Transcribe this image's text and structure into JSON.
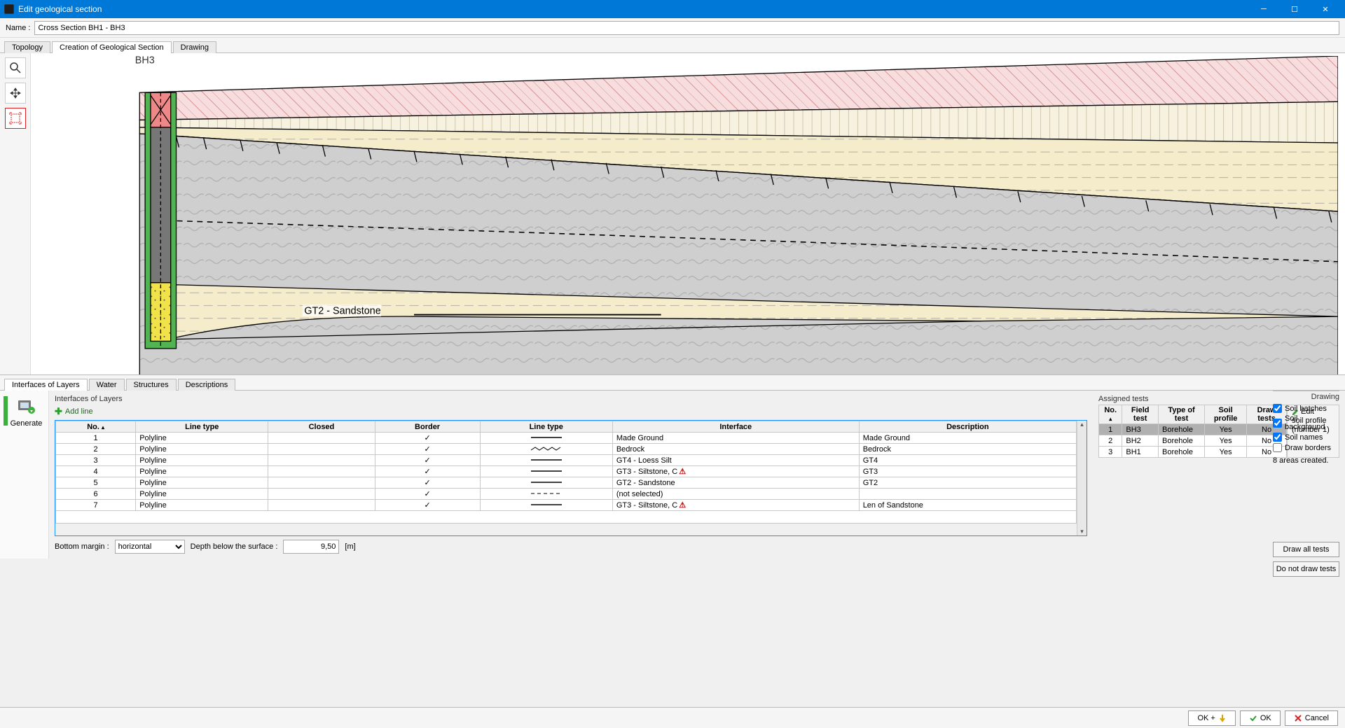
{
  "window": {
    "title": "Edit geological section"
  },
  "name_row": {
    "label": "Name :",
    "value": "Cross Section BH1 - BH3"
  },
  "main_tabs": [
    "Topology",
    "Creation of Geological Section",
    "Drawing"
  ],
  "active_main_tab": 1,
  "canvas": {
    "bh_label": "BH3",
    "lens_label": "GT2 - Sandstone"
  },
  "sub_tabs": [
    "Interfaces of Layers",
    "Water",
    "Structures",
    "Descriptions"
  ],
  "active_sub_tab": 0,
  "generate": {
    "label": "Generate"
  },
  "interfaces_group": {
    "label": "Interfaces of Layers",
    "add_line": "Add line",
    "headers": [
      "No.",
      "Line type",
      "Closed",
      "Border",
      "Line type",
      "Interface",
      "Description"
    ],
    "rows": [
      {
        "no": "1",
        "ltype": "Polyline",
        "closed": "",
        "border": "✓",
        "pat": "solid",
        "iface": "Made Ground",
        "desc": "Made Ground",
        "warn": false
      },
      {
        "no": "2",
        "ltype": "Polyline",
        "closed": "",
        "border": "✓",
        "pat": "zigzag",
        "iface": "Bedrock",
        "desc": "Bedrock",
        "warn": false
      },
      {
        "no": "3",
        "ltype": "Polyline",
        "closed": "",
        "border": "✓",
        "pat": "solid",
        "iface": "GT4 - Loess Silt",
        "desc": "GT4",
        "warn": false
      },
      {
        "no": "4",
        "ltype": "Polyline",
        "closed": "",
        "border": "✓",
        "pat": "solid",
        "iface": "GT3 - Siltstone, C",
        "desc": "GT3",
        "warn": true
      },
      {
        "no": "5",
        "ltype": "Polyline",
        "closed": "",
        "border": "✓",
        "pat": "solid",
        "iface": "GT2 - Sandstone",
        "desc": "GT2",
        "warn": false
      },
      {
        "no": "6",
        "ltype": "Polyline",
        "closed": "",
        "border": "✓",
        "pat": "dashed",
        "iface": "(not selected)",
        "desc": "",
        "warn": false
      },
      {
        "no": "7",
        "ltype": "Polyline",
        "closed": "",
        "border": "✓",
        "pat": "solid",
        "iface": "GT3 - Siltstone, C",
        "desc": "Len of Sandstone",
        "warn": true
      }
    ],
    "bottom": {
      "margin_label": "Bottom margin :",
      "margin_value": "horizontal",
      "depth_label": "Depth below the surface :",
      "depth_value": "9,50",
      "depth_unit": "[m]"
    }
  },
  "assigned": {
    "label": "Assigned tests",
    "headers": [
      "No.",
      "Field test",
      "Type of test",
      "Soil profile",
      "Draw tests"
    ],
    "rows": [
      {
        "no": "1",
        "ft": "BH3",
        "tt": "Borehole",
        "sp": "Yes",
        "dt": "No",
        "sel": true
      },
      {
        "no": "2",
        "ft": "BH2",
        "tt": "Borehole",
        "sp": "Yes",
        "dt": "No",
        "sel": false
      },
      {
        "no": "3",
        "ft": "BH1",
        "tt": "Borehole",
        "sp": "Yes",
        "dt": "No",
        "sel": false
      }
    ],
    "edit": {
      "l1": "Edit",
      "l2": "soil profile",
      "l3": "(number 1)"
    }
  },
  "drawing": {
    "heading": "Drawing",
    "opts": [
      {
        "label": "Soil hatches",
        "checked": true
      },
      {
        "label": "Soil background",
        "checked": true
      },
      {
        "label": "Soil names",
        "checked": true
      },
      {
        "label": "Draw borders",
        "checked": false
      }
    ],
    "info": "8 areas created.",
    "btn_all": "Draw all tests",
    "btn_none": "Do not draw tests"
  },
  "footer": {
    "okplus": "OK +",
    "ok": "OK",
    "cancel": "Cancel"
  }
}
